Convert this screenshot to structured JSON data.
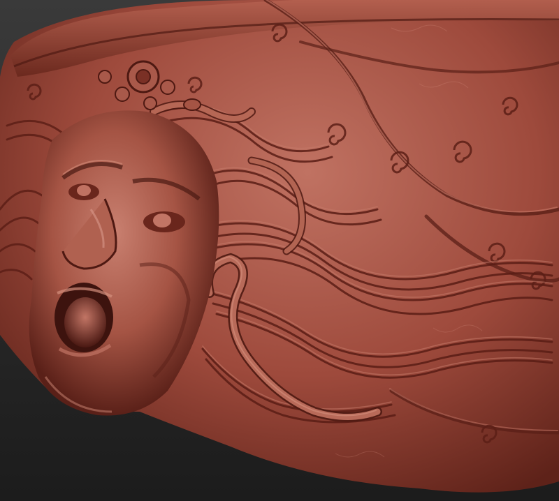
{
  "scene": {
    "subject": "medusa-relief-sculpt",
    "palette": {
      "background_top": "#3a3a3a",
      "background_bottom": "#1c1c1c",
      "clay_light": "#c27060",
      "clay_mid": "#9e4a3c",
      "clay_dark": "#5e2219",
      "clay_shadow": "#3a1410"
    }
  }
}
